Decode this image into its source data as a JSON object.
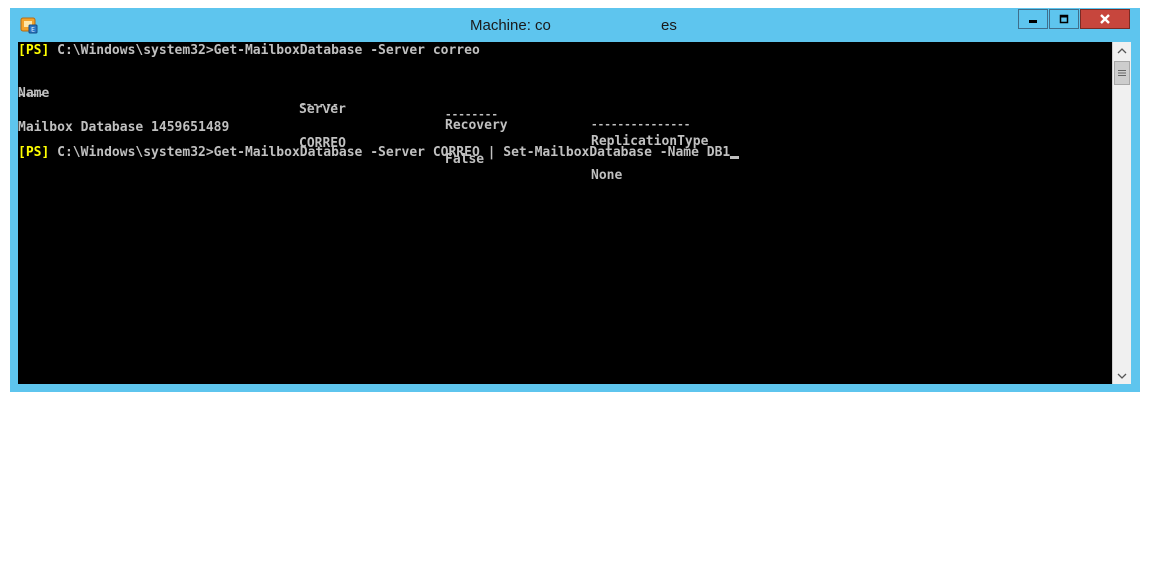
{
  "window": {
    "title_left": "Machine: co",
    "title_right": "es",
    "app_icon": "powershell-exchange-icon",
    "colors": {
      "frame": "#5ec5ee",
      "console_bg": "#000000",
      "console_text": "#c0c0c0",
      "prompt": "#ffff00",
      "close": "#c7463d"
    }
  },
  "console": {
    "prompt_tag": "[PS]",
    "cmd1": " C:\\Windows\\system32>Get-MailboxDatabase -Server correo",
    "headers": [
      "Name",
      "Server",
      "Recovery",
      "ReplicationType"
    ],
    "underlines": [
      "----",
      "------",
      "--------",
      "---------------"
    ],
    "row": [
      "Mailbox Database 1459651489",
      "CORREO",
      "False",
      "None"
    ],
    "cmd2": " C:\\Windows\\system32>Get-MailboxDatabase -Server CORREO | Set-MailboxDatabase -Name DB1"
  }
}
